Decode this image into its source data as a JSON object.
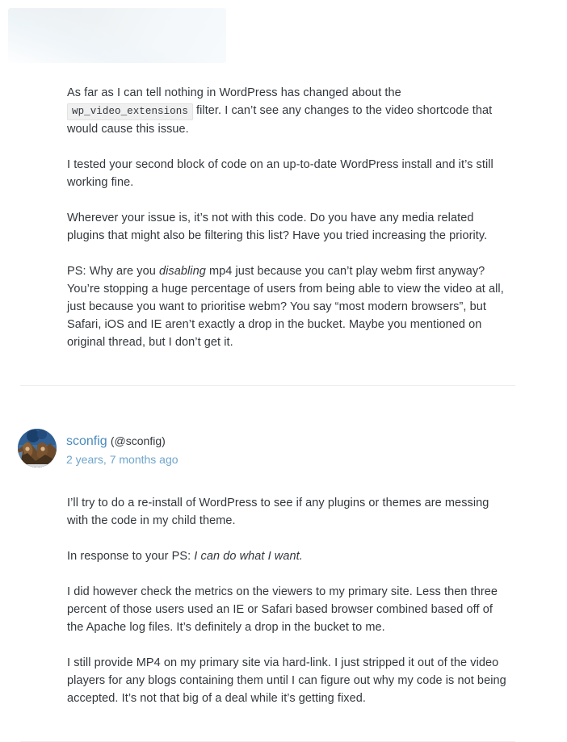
{
  "ghost_block": {
    "label": "scrolled-off-content-placeholder"
  },
  "replies": [
    {
      "id": "reply-1",
      "paragraphs": [
        {
          "parts": [
            {
              "type": "text",
              "value": "As far as I can tell nothing in WordPress has changed about the "
            },
            {
              "type": "code",
              "value": "wp_video_extensions"
            },
            {
              "type": "text",
              "value": " filter. I can’t see any changes to the video shortcode that would cause this issue."
            }
          ]
        },
        {
          "parts": [
            {
              "type": "text",
              "value": "I tested your second block of code on an up-to-date WordPress install and it’s still working fine."
            }
          ]
        },
        {
          "parts": [
            {
              "type": "text",
              "value": "Wherever your issue is, it’s not with this code. Do you have any media related plugins that might also be filtering this list? Have you tried increasing the priority."
            }
          ]
        },
        {
          "parts": [
            {
              "type": "text",
              "value": "PS: Why are you "
            },
            {
              "type": "em",
              "value": "disabling"
            },
            {
              "type": "text",
              "value": " mp4 just because you can’t play webm first anyway? You’re stopping a huge percentage of users from being able to view the video at all, just because you want to prioritise webm? You say “most modern browsers”, but Safari, iOS and IE aren’t exactly a drop in the bucket. Maybe you mentioned on original thread, but I don’t get it."
            }
          ]
        }
      ]
    },
    {
      "id": "reply-2",
      "author": {
        "name": "sconfig",
        "handle": "(@sconfig)",
        "timestamp": "2 years, 7 months ago",
        "avatar_alt": "sconfig-avatar"
      },
      "paragraphs": [
        {
          "parts": [
            {
              "type": "text",
              "value": "I’ll try to do a re-install of WordPress to see if any plugins or themes are messing with the code in my child theme."
            }
          ]
        },
        {
          "parts": [
            {
              "type": "text",
              "value": "In response to your PS: "
            },
            {
              "type": "em",
              "value": "I can do what I want."
            }
          ]
        },
        {
          "parts": [
            {
              "type": "text",
              "value": "I did however check the metrics on the viewers to my primary site. Less then three percent of those users used an IE or Safari based browser combined based off of the Apache log files. It’s definitely a drop in the bucket to me."
            }
          ]
        },
        {
          "parts": [
            {
              "type": "text",
              "value": "I still provide MP4 on my primary site via hard-link. I just stripped it out of the video players for any blogs containing them until I can figure out why my code is not being accepted. It’s not that big of a deal while it’s getting fixed."
            }
          ]
        }
      ]
    }
  ],
  "colors": {
    "text": "#32373c",
    "link": "#4a8bbd",
    "timestamp": "#6fa5cc",
    "code_bg": "#f0f0f0",
    "code_border": "#e3e3e3",
    "divider": "#eceef0"
  }
}
